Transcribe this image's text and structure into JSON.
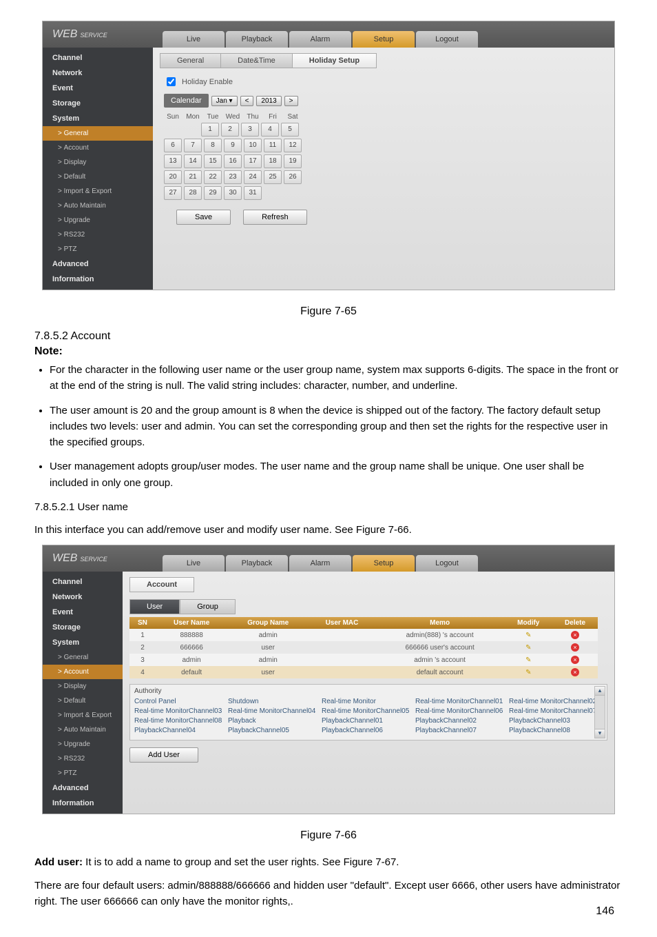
{
  "page_number": "146",
  "webservice_prefix": "WEB",
  "webservice_suffix": "SERVICE",
  "fig1": {
    "caption": "Figure 7-65",
    "tabs": {
      "live": "Live",
      "playback": "Playback",
      "alarm": "Alarm",
      "setup": "Setup",
      "logout": "Logout"
    },
    "side": {
      "channel": "Channel",
      "network": "Network",
      "event": "Event",
      "storage": "Storage",
      "system": "System",
      "general": "General",
      "account": "Account",
      "display": "Display",
      "default": "Default",
      "impexp": "Import & Export",
      "automaintain": "Auto Maintain",
      "upgrade": "Upgrade",
      "rs232": "RS232",
      "ptz": "PTZ",
      "advanced": "Advanced",
      "information": "Information"
    },
    "subtabs": {
      "general": "General",
      "datetime": "Date&Time",
      "holiday": "Holiday Setup"
    },
    "holiday_enable": "Holiday Enable",
    "calendar_label": "Calendar",
    "month": "Jan",
    "year": "2013",
    "dow": {
      "sun": "Sun",
      "mon": "Mon",
      "tue": "Tue",
      "wed": "Wed",
      "thu": "Thu",
      "fri": "Fri",
      "sat": "Sat"
    },
    "save": "Save",
    "refresh": "Refresh"
  },
  "body": {
    "sec_account": "7.8.5.2 Account",
    "note": "Note:",
    "b1": "For the character in the following user name or the user group name, system max supports 6-digits. The space in the front or at the end of the string is null. The valid string includes: character, number, and underline.",
    "b2": "The user amount is 20 and the group amount is 8 when the device is shipped out of the factory. The factory default setup includes two levels: user and admin. You can set the corresponding group and then set the rights for the respective user in the specified groups.",
    "b3": "User management adopts group/user modes. The user name and the group name shall be unique. One user shall be included in only one group.",
    "sec_username": "7.8.5.2.1   User name",
    "p_intro": "In this interface you can add/remove user and modify user name. See Figure 7-66."
  },
  "fig2": {
    "caption": "Figure 7-66",
    "tabs": {
      "live": "Live",
      "playback": "Playback",
      "alarm": "Alarm",
      "setup": "Setup",
      "logout": "Logout"
    },
    "side": {
      "channel": "Channel",
      "network": "Network",
      "event": "Event",
      "storage": "Storage",
      "system": "System",
      "general": "General",
      "account": "Account",
      "display": "Display",
      "default": "Default",
      "impexp": "Import & Export",
      "automaintain": "Auto Maintain",
      "upgrade": "Upgrade",
      "rs232": "RS232",
      "ptz": "PTZ",
      "advanced": "Advanced",
      "information": "Information"
    },
    "account_tab": "Account",
    "user_tab": "User",
    "group_tab": "Group",
    "th": {
      "sn": "SN",
      "uname": "User Name",
      "gname": "Group Name",
      "umac": "User MAC",
      "memo": "Memo",
      "modify": "Modify",
      "delete": "Delete"
    },
    "rows": [
      {
        "sn": "1",
        "un": "888888",
        "gn": "admin",
        "mac": "",
        "memo": "admin(888) 's account"
      },
      {
        "sn": "2",
        "un": "666666",
        "gn": "user",
        "mac": "",
        "memo": "666666 user's account"
      },
      {
        "sn": "3",
        "un": "admin",
        "gn": "admin",
        "mac": "",
        "memo": "admin 's account"
      },
      {
        "sn": "4",
        "un": "default",
        "gn": "user",
        "mac": "",
        "memo": "default account"
      }
    ],
    "authority_label": "Authority",
    "authorities": [
      "Control Panel",
      "Shutdown",
      "Real-time Monitor",
      "Real-time MonitorChannel01",
      "Real-time MonitorChannel02",
      "Real-time MonitorChannel03",
      "Real-time MonitorChannel04",
      "Real-time MonitorChannel05",
      "Real-time MonitorChannel06",
      "Real-time MonitorChannel07",
      "Real-time MonitorChannel08",
      "Playback",
      "PlaybackChannel01",
      "PlaybackChannel02",
      "PlaybackChannel03",
      "PlaybackChannel04",
      "PlaybackChannel05",
      "PlaybackChannel06",
      "PlaybackChannel07",
      "PlaybackChannel08"
    ],
    "add_user": "Add User"
  },
  "trailer": {
    "adduser_label": "Add user:",
    "adduser_rest": " It is to add a name to group and set the user rights. See Figure 7-67.",
    "l2": "There are four default users: admin/888888/666666 and hidden user \"default\". Except user 6666, other users have administrator right. The user 666666 can only have the monitor rights,."
  }
}
